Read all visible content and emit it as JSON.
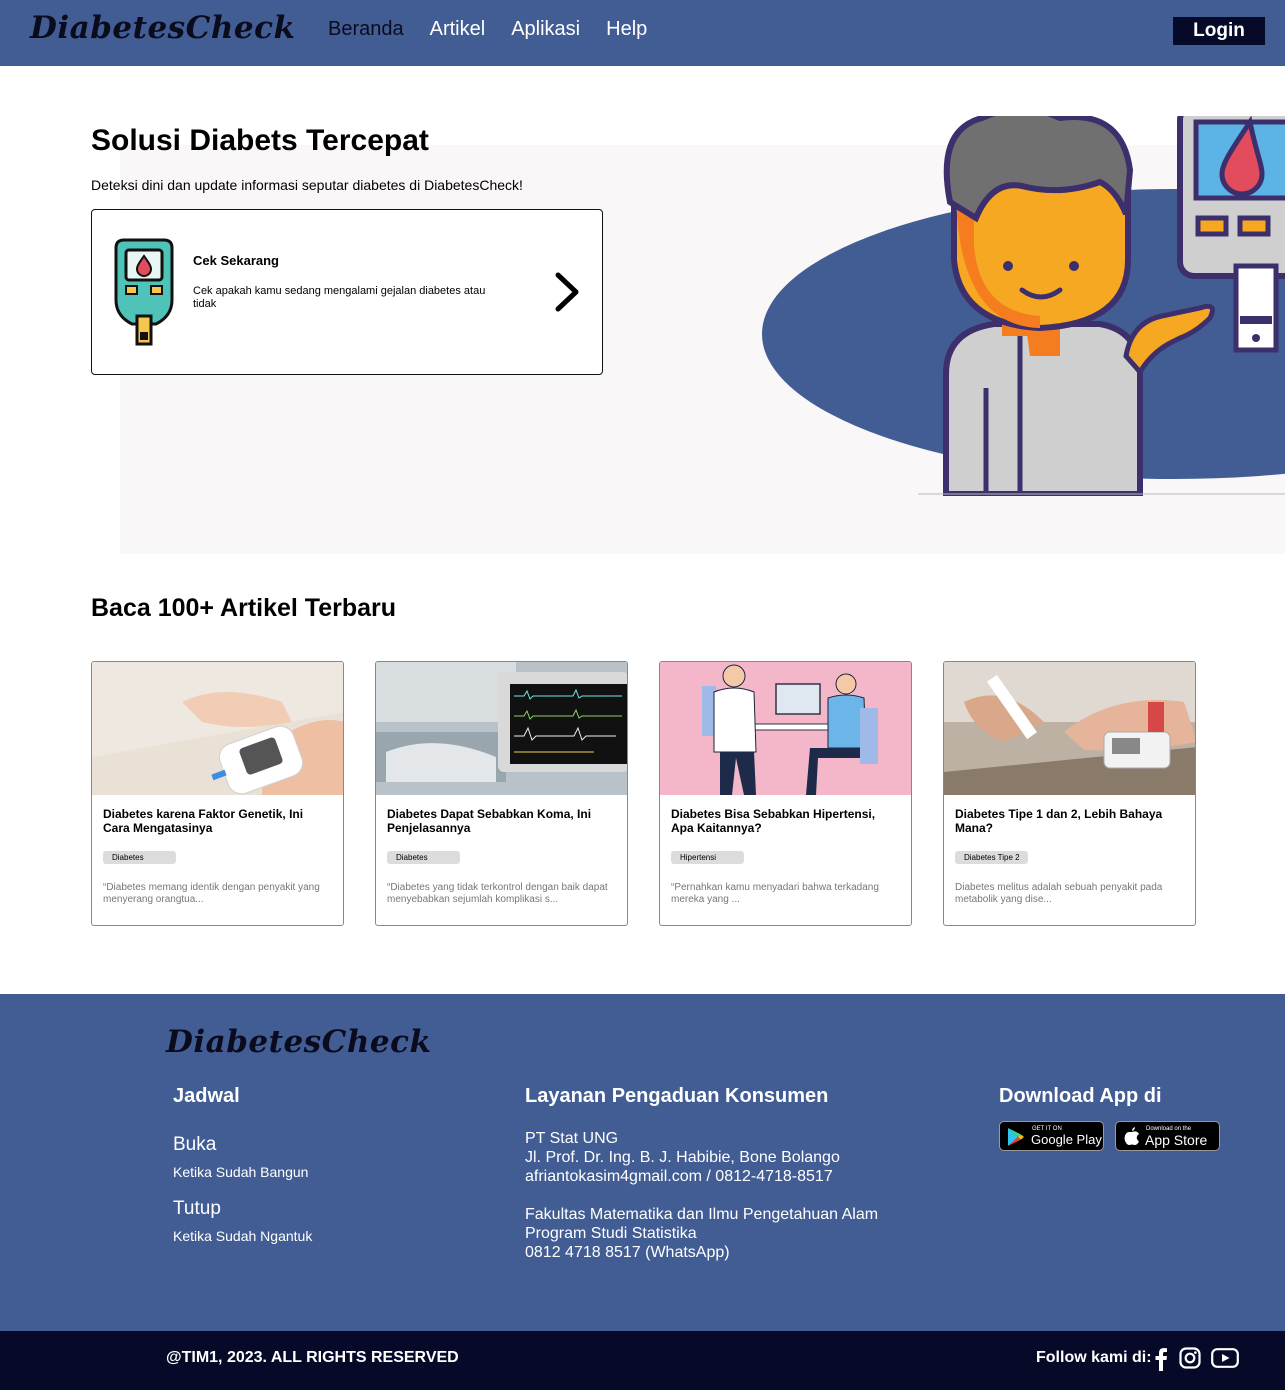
{
  "brand": {
    "logo_text": "DiabetesCheck"
  },
  "nav": {
    "items": [
      "Beranda",
      "Artikel",
      "Aplikasi",
      "Help"
    ],
    "active": "Beranda",
    "login_label": "Login"
  },
  "hero": {
    "title": "Solusi Diabets Tercepat",
    "subtitle": "Deteksi dini dan update informasi seputar diabetes di DiabetesCheck!",
    "card": {
      "title": "Cek Sekarang",
      "description": "Cek apakah kamu sedang mengalami gejalan diabetes atau tidak"
    }
  },
  "articles_section": {
    "title": "Baca 100+ Artikel Terbaru",
    "items": [
      {
        "title": "Diabetes karena Faktor Genetik, Ini Cara Mengatasinya",
        "tag": "Diabetes",
        "excerpt": "“Diabetes memang identik dengan penyakit yang menyerang orangtua..."
      },
      {
        "title": "Diabetes Dapat Sebabkan Koma, Ini Penjelasannya",
        "tag": "Diabetes",
        "excerpt": "“Diabetes yang tidak terkontrol dengan baik dapat menyebabkan sejumlah komplikasi s..."
      },
      {
        "title": "Diabetes Bisa Sebabkan Hipertensi, Apa Kaitannya?",
        "tag": "Hipertensi",
        "excerpt": "“Pernahkan kamu menyadari bahwa terkadang mereka yang ..."
      },
      {
        "title": "Diabetes Tipe 1 dan 2, Lebih Bahaya Mana?",
        "tag": "Diabetes Tipe 2",
        "excerpt": "Diabetes melitus adalah sebuah penyakit pada metabolik yang dise..."
      }
    ]
  },
  "footer": {
    "schedule": {
      "heading": "Jadwal",
      "open_label": "Buka",
      "open_value": "Ketika Sudah Bangun",
      "close_label": "Tutup",
      "close_value": "Ketika Sudah Ngantuk"
    },
    "complaints": {
      "heading": "Layanan Pengaduan Konsumen",
      "lines_1": [
        "PT Stat UNG",
        "Jl. Prof. Dr. Ing. B. J. Habibie, Bone Bolango",
        "afriantokasim4gmail.com / 0812-4718-8517"
      ],
      "lines_2": [
        "Fakultas Matematika dan Ilmu Pengetahuan Alam",
        "Program Studi Statistika",
        "0812 4718 8517 (WhatsApp)"
      ]
    },
    "download": {
      "heading": "Download App di",
      "google_small": "GET IT ON",
      "google_big": "Google Play",
      "apple_small": "Download on the",
      "apple_big": "App Store"
    },
    "copyright": "@TIM1, 2023. ALL RIGHTS RESERVED",
    "follow_label": "Follow kami di:",
    "social_icons": [
      "facebook-icon",
      "instagram-icon",
      "youtube-icon"
    ]
  },
  "colors": {
    "primary": "#415d94",
    "dark": "#060a28",
    "hero_bg": "#f9f7f8"
  }
}
